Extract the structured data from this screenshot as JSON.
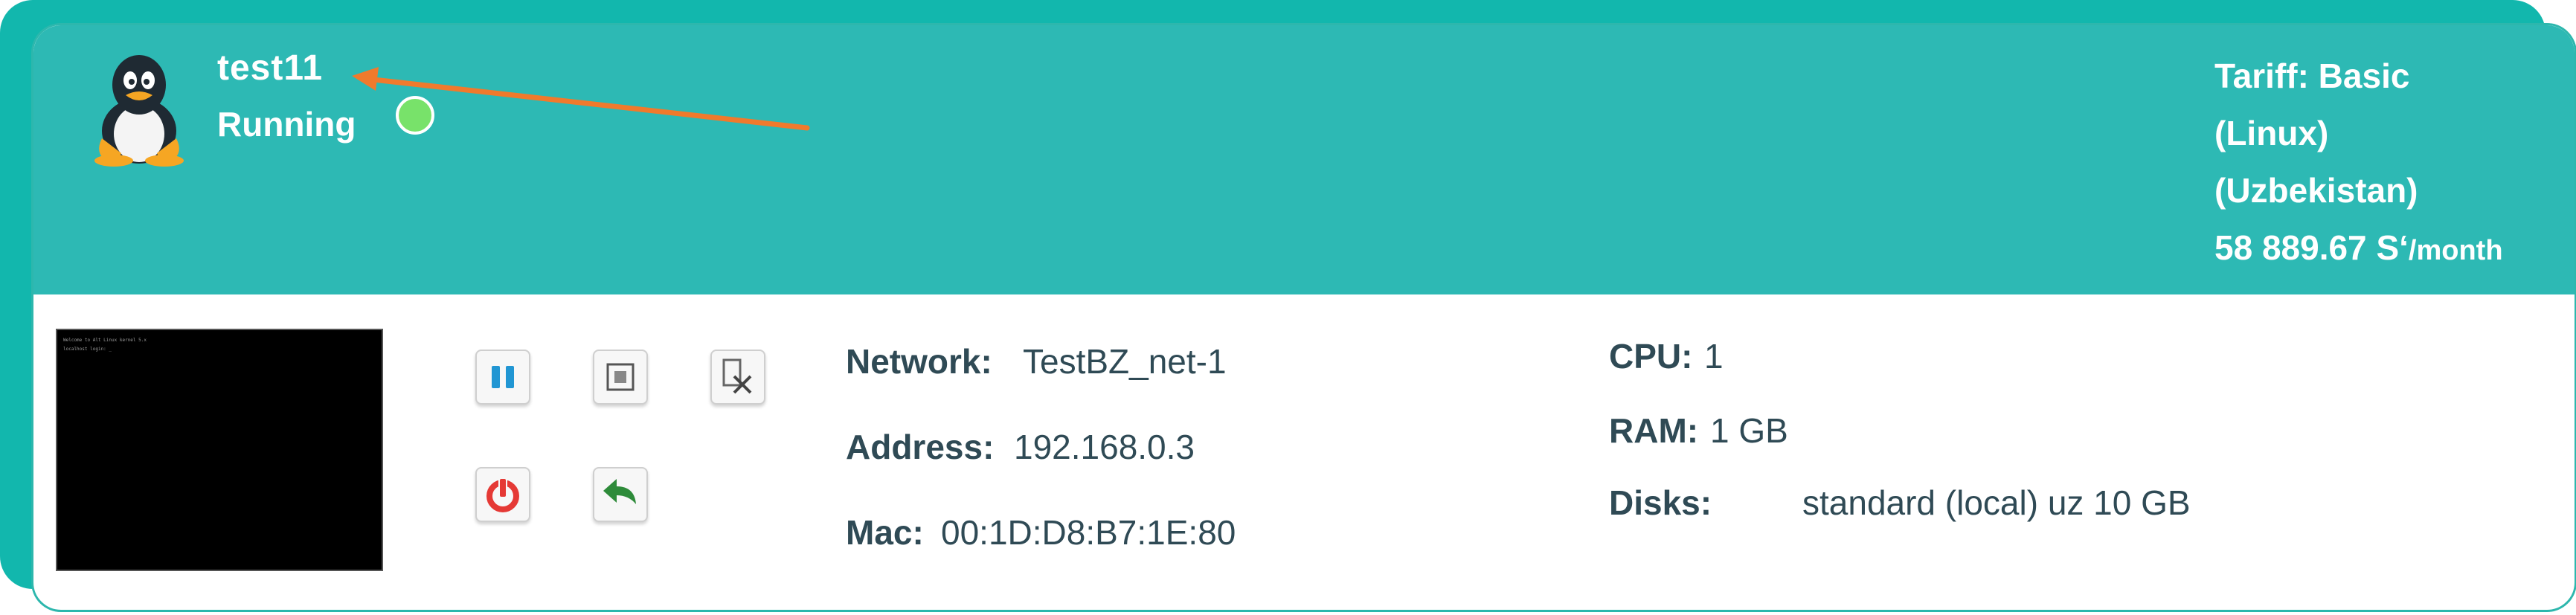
{
  "vm": {
    "name": "test11",
    "status": "Running",
    "status_color": "#78e26a",
    "os_icon": "tux-penguin-icon"
  },
  "tariff": {
    "line1": "Tariff: Basic",
    "line2": "(Linux)",
    "line3": "(Uzbekistan)",
    "price": "58 889.67 сум",
    "price_amount": "58 889.67",
    "price_currency": "Sʻ",
    "price_unit": "/month"
  },
  "console": {
    "line1": "Welcome to Alt Linux kernel 5.x",
    "line2": "localhost login: _"
  },
  "controls": [
    {
      "name": "pause-button",
      "icon": "pause-icon"
    },
    {
      "name": "stop-button",
      "icon": "stop-icon"
    },
    {
      "name": "delete-button",
      "icon": "delete-vm-icon"
    },
    {
      "name": "power-button",
      "icon": "power-icon"
    },
    {
      "name": "restart-button",
      "icon": "return-arrow-icon"
    }
  ],
  "network": {
    "network_label": "Network:",
    "network_value": "TestBZ_net-1",
    "address_label": "Address:",
    "address_value": "192.168.0.3",
    "mac_label": "Mac:",
    "mac_value": "00:1D:D8:B7:1E:80"
  },
  "resources": {
    "cpu_label": "CPU:",
    "cpu_value": "1",
    "ram_label": "RAM:",
    "ram_value": "1 GB",
    "disks_label": "Disks:",
    "disks_value": "standard (local) uz 10 GB"
  },
  "colors": {
    "header_bg": "#2db9b4",
    "outer_bg": "#12b7ad",
    "text_dark": "#2f4a55",
    "annotation_arrow": "#f07a2c",
    "pause_blue": "#2196d3",
    "power_red": "#e53935",
    "return_green": "#2e8b3a"
  }
}
